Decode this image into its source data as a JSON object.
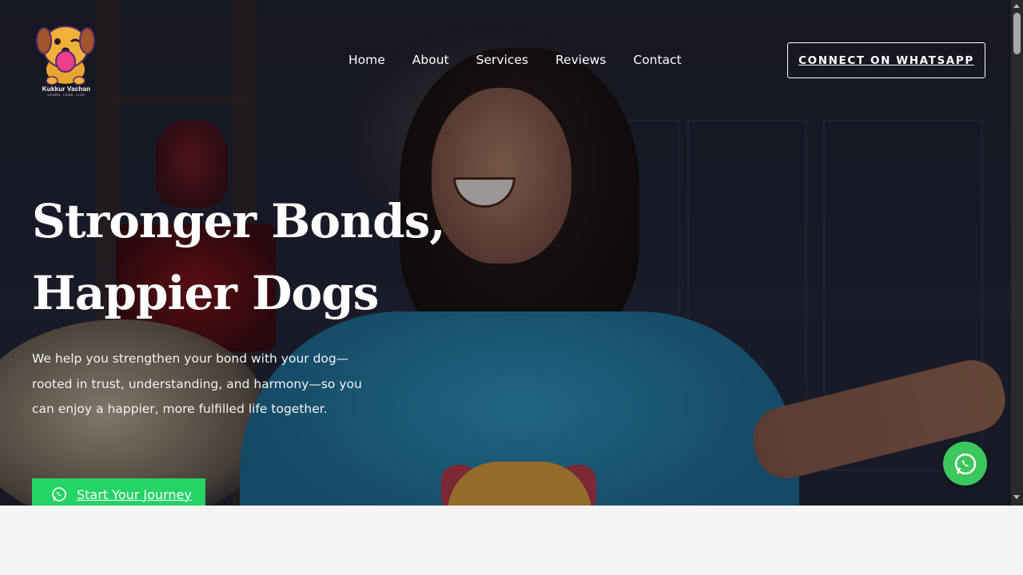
{
  "brand": {
    "name": "Kukkur Vachan",
    "tagline": "LEARN. LEAD. LIVE"
  },
  "nav": {
    "items": [
      {
        "label": "Home"
      },
      {
        "label": "About"
      },
      {
        "label": "Services"
      },
      {
        "label": "Reviews"
      },
      {
        "label": "Contact"
      }
    ]
  },
  "header": {
    "cta_label": "CONNECT ON WHATSAPP"
  },
  "hero": {
    "headline_line1": "Stronger Bonds,",
    "headline_line2": "Happier Dogs",
    "subtext": "We help you strengthen your bond with your dog—rooted in trust, understanding, and harmony—so you can enjoy a happier, more fulfilled life together.",
    "cta_label": "Start Your Journey",
    "cta_icon": "whatsapp-icon"
  },
  "floating": {
    "icon": "whatsapp-icon"
  },
  "colors": {
    "whatsapp_green": "#25d366",
    "float_green": "#3cc75d",
    "page_bg": "#f6f4f4"
  }
}
